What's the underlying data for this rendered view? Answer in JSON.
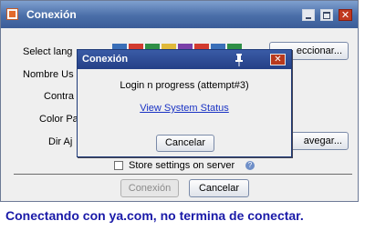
{
  "window": {
    "title": "Conexión",
    "colors": {
      "titlebar": "#4a6ea8",
      "close": "#c0381e"
    }
  },
  "form": {
    "labels": {
      "language": "Select lang",
      "username": "Nombre Us",
      "password": "Contra",
      "color": "Color Pa",
      "directory": "Dir Aj"
    },
    "select_button": "eccionar...",
    "browse_button": "avegar...",
    "store_settings": "Store settings on server",
    "flag_colors": [
      "#3a6fb8",
      "#d23b2f",
      "#2f8f46",
      "#e0b93a",
      "#7a3fa8",
      "#d23b2f",
      "#3a6fb8",
      "#2f8f46",
      "#d23b2f"
    ]
  },
  "footer": {
    "connect": "Conexión",
    "cancel": "Cancelar"
  },
  "dialog": {
    "title": "Conexión",
    "message": "Login n progress (attempt#3)",
    "link": "View System Status",
    "cancel": "Cancelar",
    "link_color": "#1a33c4"
  },
  "caption": "Conectando con ya.com, no termina de conectar."
}
